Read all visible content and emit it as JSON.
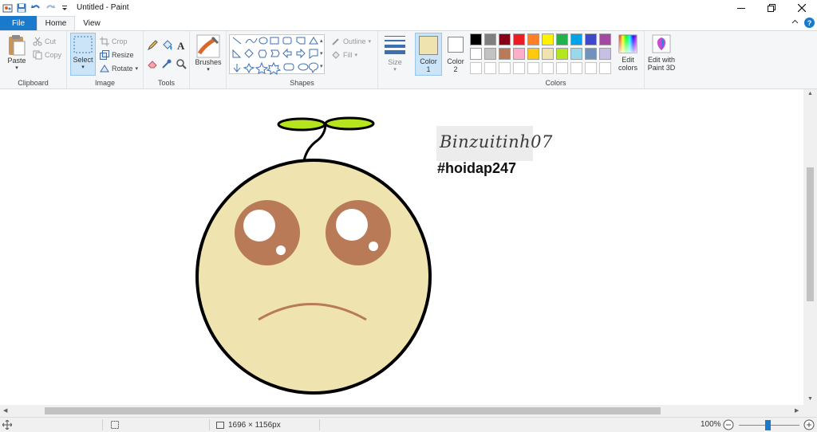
{
  "window": {
    "title": "Untitled - Paint"
  },
  "tabs": {
    "file": "File",
    "home": "Home",
    "view": "View"
  },
  "ribbon": {
    "clipboard": {
      "label": "Clipboard",
      "paste": "Paste",
      "cut": "Cut",
      "copy": "Copy"
    },
    "image": {
      "label": "Image",
      "select": "Select",
      "crop": "Crop",
      "resize": "Resize",
      "rotate": "Rotate"
    },
    "tools": {
      "label": "Tools"
    },
    "brushes": {
      "label": "Brushes"
    },
    "shapes": {
      "label": "Shapes",
      "outline": "Outline",
      "fill": "Fill"
    },
    "size": {
      "label": "Size"
    },
    "color1": {
      "label": "Color",
      "num": "1",
      "value": "#efe4b0"
    },
    "color2": {
      "label": "Color",
      "num": "2",
      "value": "#ffffff"
    },
    "colors": {
      "label": "Colors",
      "row1": [
        "#000000",
        "#7f7f7f",
        "#880015",
        "#ed1c24",
        "#ff7f27",
        "#fff200",
        "#22b14c",
        "#00a2e8",
        "#3f48cc",
        "#a349a4"
      ],
      "row2": [
        "#ffffff",
        "#c3c3c3",
        "#b97a57",
        "#ffaec9",
        "#ffc90e",
        "#efe4b0",
        "#b5e61d",
        "#99d9ea",
        "#7092be",
        "#c8bfe7"
      ]
    },
    "edit_colors": {
      "line1": "Edit",
      "line2": "colors"
    },
    "paint3d": {
      "line1": "Edit with",
      "line2": "Paint 3D"
    }
  },
  "canvas": {
    "watermark": "Binzuitinh07",
    "hashtag": "#hoidap247"
  },
  "status": {
    "dimensions": "1696 × 1156px",
    "zoom": "100%"
  }
}
